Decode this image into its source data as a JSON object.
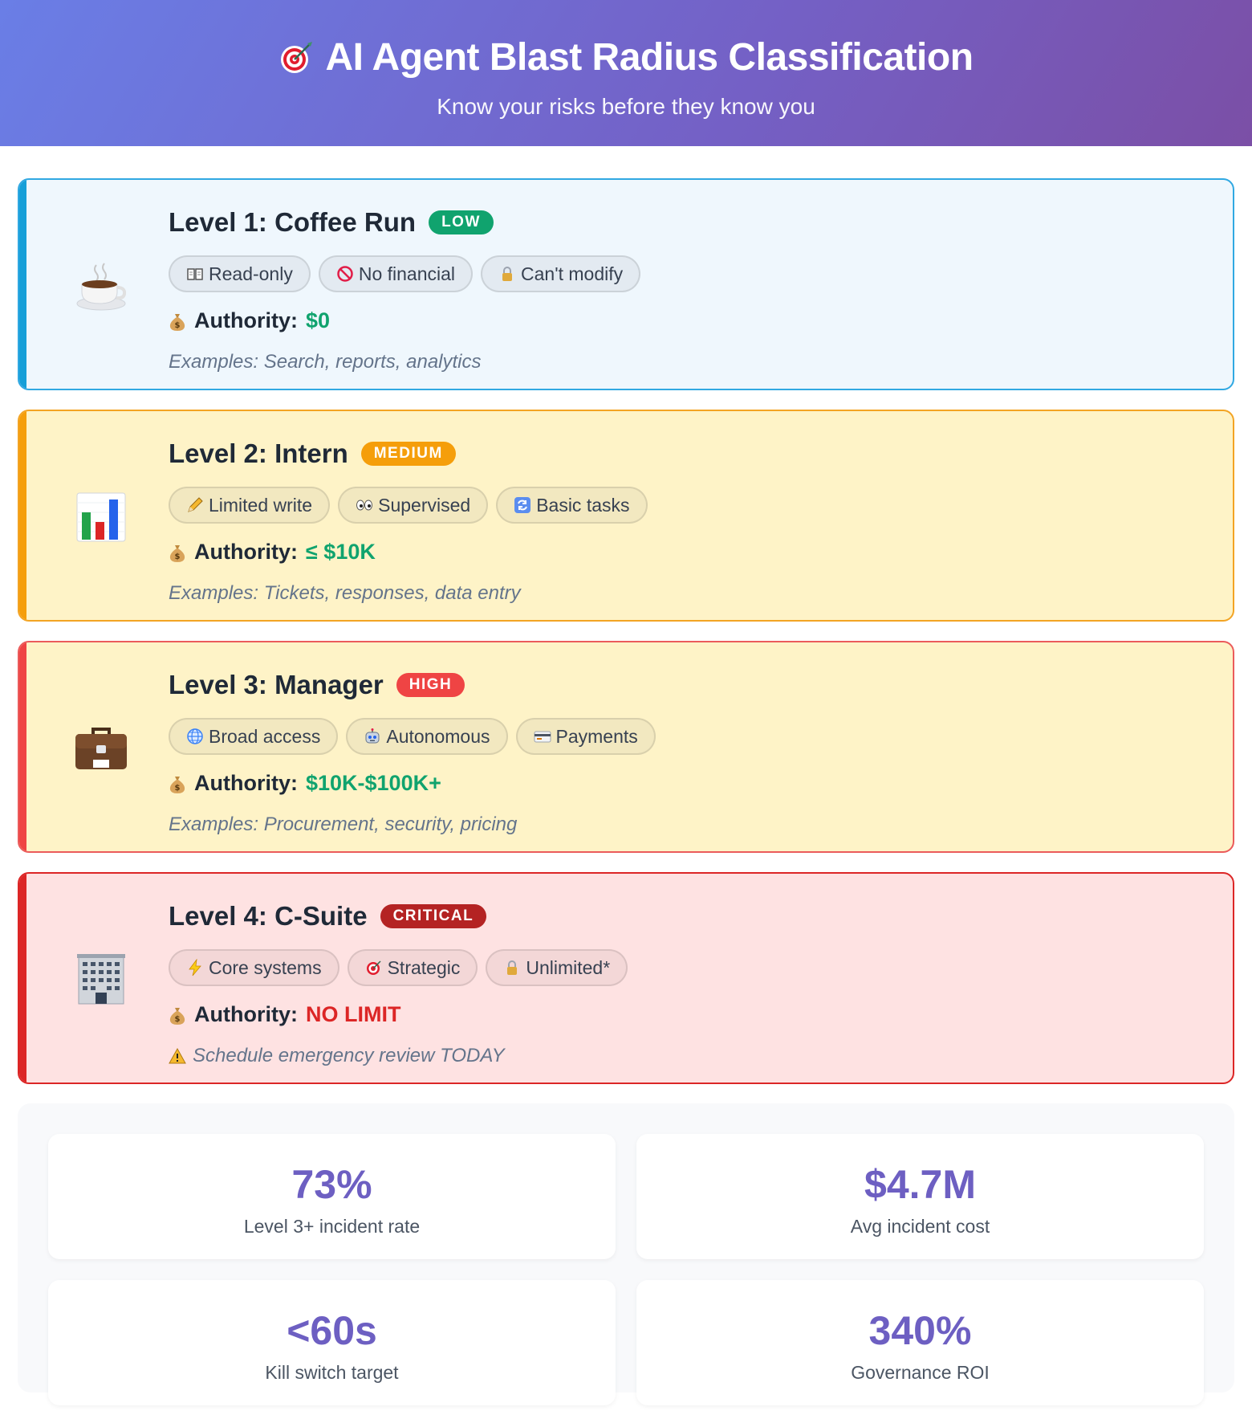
{
  "header": {
    "title": "AI Agent Blast Radius Classification",
    "subtitle": "Know your risks before they know you"
  },
  "levels": [
    {
      "title": "Level 1: Coffee Run",
      "badge": "LOW",
      "badge_color": "#10a36e",
      "emoji": "coffee-icon",
      "tags": [
        "Read-only",
        "No financial",
        "Can't modify"
      ],
      "tag_icons": [
        "book-icon",
        "no-entry-icon",
        "lock-icon"
      ],
      "authority_label": "Authority:",
      "authority_value": "$0",
      "authority_color": "#10a36e",
      "examples": "Examples: Search, reports, analytics"
    },
    {
      "title": "Level 2: Intern",
      "badge": "MEDIUM",
      "badge_color": "#f59e0b",
      "emoji": "bar-chart-icon",
      "tags": [
        "Limited write",
        "Supervised",
        "Basic tasks"
      ],
      "tag_icons": [
        "pencil-icon",
        "eyes-icon",
        "refresh-icon"
      ],
      "authority_label": "Authority:",
      "authority_value": "≤ $10K",
      "authority_color": "#10a36e",
      "examples": "Examples: Tickets, responses, data entry"
    },
    {
      "title": "Level 3: Manager",
      "badge": "HIGH",
      "badge_color": "#ef4444",
      "emoji": "briefcase-icon",
      "tags": [
        "Broad access",
        "Autonomous",
        "Payments"
      ],
      "tag_icons": [
        "globe-icon",
        "robot-icon",
        "card-icon"
      ],
      "authority_label": "Authority:",
      "authority_value": "$10K-$100K+",
      "authority_color": "#10a36e",
      "examples": "Examples: Procurement, security, pricing"
    },
    {
      "title": "Level 4: C-Suite",
      "badge": "CRITICAL",
      "badge_color": "#b42323",
      "emoji": "office-building-icon",
      "tags": [
        "Core systems",
        "Strategic",
        "Unlimited*"
      ],
      "tag_icons": [
        "lightning-icon",
        "target-icon",
        "lock-icon"
      ],
      "authority_label": "Authority:",
      "authority_value": "NO LIMIT",
      "authority_color": "#dc2626",
      "examples": "Schedule emergency review TODAY"
    }
  ],
  "stats": [
    {
      "value": "73%",
      "caption": "Level 3+ incident rate"
    },
    {
      "value": "$4.7M",
      "caption": "Avg incident cost"
    },
    {
      "value": "<60s",
      "caption": "Kill switch target"
    },
    {
      "value": "340%",
      "caption": "Governance ROI"
    }
  ]
}
